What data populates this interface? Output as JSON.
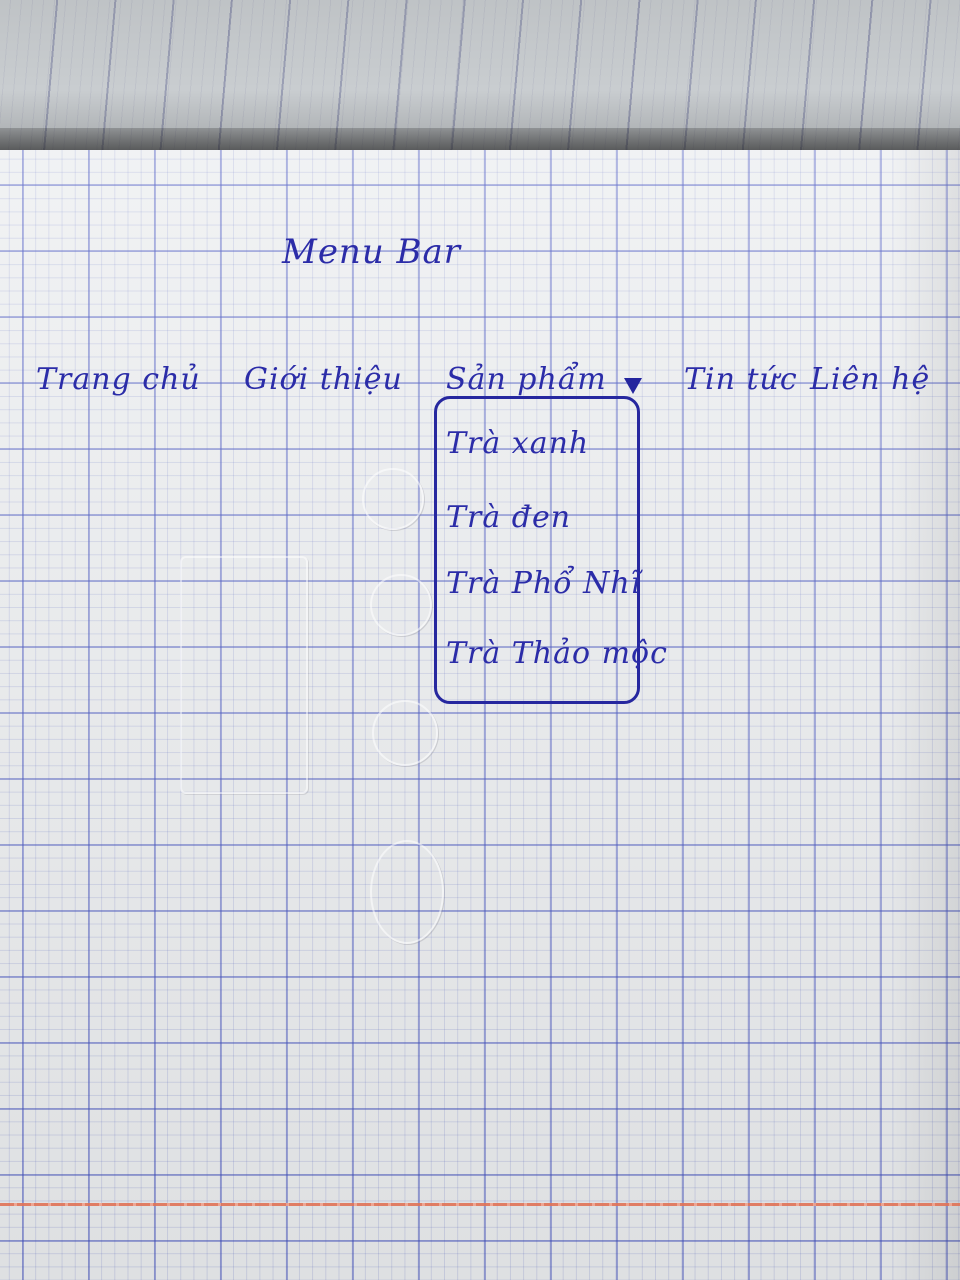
{
  "sketch": {
    "title": "Menu Bar",
    "nav_items": [
      {
        "label": "Trang chủ"
      },
      {
        "label": "Giới thiệu"
      },
      {
        "label": "Sản phẩm",
        "has_dropdown": true
      },
      {
        "label": "Tin tức"
      },
      {
        "label": "Liên hệ"
      }
    ],
    "dropdown_items": [
      {
        "label": "Trà xanh"
      },
      {
        "label": "Trà đen"
      },
      {
        "label": "Trà Phổ Nhĩ"
      },
      {
        "label": "Trà Thảo mộc"
      }
    ],
    "dropdown_icon": "triangle-down-icon"
  },
  "colors": {
    "ink": "#2b2ca8",
    "grid": "#3c4bbe",
    "paper": "#eceef0",
    "margin_line": "#e07256"
  }
}
